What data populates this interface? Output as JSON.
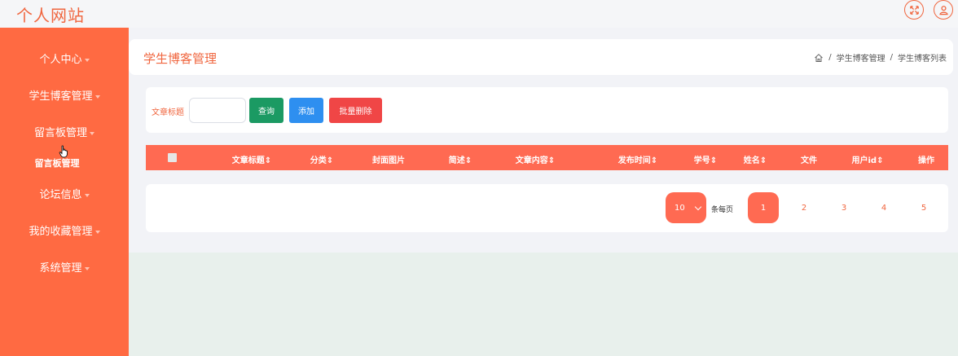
{
  "header": {
    "site_title": "个人网站",
    "icons": [
      "fullscreen-icon",
      "user-icon"
    ]
  },
  "sidebar": {
    "items": [
      {
        "label": "个人中心"
      },
      {
        "label": "学生博客管理"
      },
      {
        "label": "留言板管理"
      },
      {
        "label": "论坛信息"
      },
      {
        "label": "我的收藏管理"
      },
      {
        "label": "系统管理"
      }
    ],
    "submenu": {
      "label": "留言板管理"
    }
  },
  "page": {
    "title": "学生博客管理",
    "breadcrumb": {
      "level1": "学生博客管理",
      "separator": "/",
      "level2": "学生博客列表"
    }
  },
  "search": {
    "label": "文章标题",
    "placeholder": "",
    "value": "",
    "query_button": "查询",
    "add_button": "添加",
    "batch_delete_button": "批量删除"
  },
  "table": {
    "columns": [
      "文章标题",
      "分类",
      "封面图片",
      "简述",
      "文章内容",
      "发布时间",
      "学号",
      "姓名",
      "文件",
      "用户id",
      "操作"
    ],
    "sortable": [
      true,
      true,
      false,
      true,
      true,
      true,
      true,
      true,
      false,
      true,
      false
    ]
  },
  "pagination": {
    "page_size": "10",
    "per_page_label": "条每页",
    "pages": [
      "1",
      "2",
      "3",
      "4",
      "5"
    ],
    "current": "1"
  },
  "colors": {
    "accent": "#f0663f",
    "sidebar_bg": "#ff6a42",
    "header_row": "#ff6a52",
    "query_btn": "#1b9a63",
    "add_btn": "#2e8ff0",
    "delete_btn": "#f04646"
  }
}
